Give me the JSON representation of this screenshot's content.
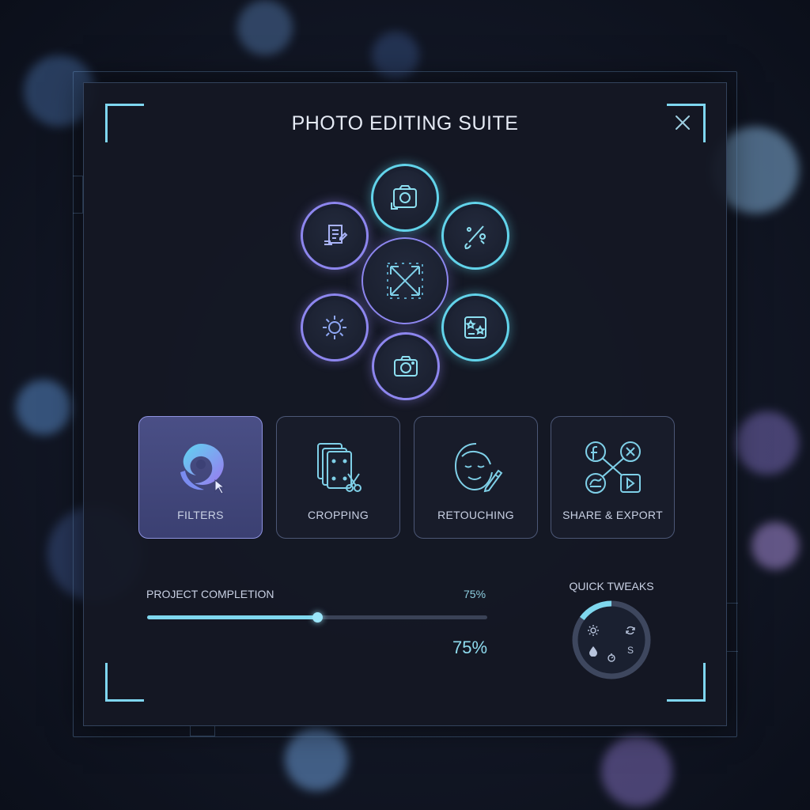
{
  "window": {
    "title": "PHOTO EDITING SUITE",
    "close_icon": "close-icon"
  },
  "tool_wheel": {
    "center_icon": "expand-arrows-icon",
    "tools": [
      {
        "icon": "camera-frame-icon",
        "color": "#62d3ea"
      },
      {
        "icon": "brush-icon",
        "color": "#62d3ea"
      },
      {
        "icon": "stickers-stars-icon",
        "color": "#62d3ea"
      },
      {
        "icon": "camera-icon",
        "color": "#8d86ee"
      },
      {
        "icon": "brightness-sun-icon",
        "color": "#8d86ee"
      },
      {
        "icon": "document-edit-icon",
        "color": "#8d86ee"
      }
    ]
  },
  "features": [
    {
      "label": "FILTERS",
      "icon": "filters-swirl-icon",
      "active": true
    },
    {
      "label": "CROPPING",
      "icon": "crop-scissors-icon",
      "active": false
    },
    {
      "label": "RETOUCHING",
      "icon": "face-retouch-icon",
      "active": false
    },
    {
      "label": "SHARE & EXPORT",
      "icon": "share-export-icon",
      "active": false
    }
  ],
  "progress": {
    "label": "PROJECT COMPLETION",
    "percent_text": "75%",
    "big_text": "75%",
    "value": 0.5
  },
  "quick_tweaks": {
    "title": "QUICK TWEAKS",
    "items": [
      {
        "icon": "brightness-icon",
        "text": ""
      },
      {
        "icon": "rotate-icon",
        "text": ""
      },
      {
        "icon": "droplet-icon",
        "text": ""
      },
      {
        "icon": "timer-icon",
        "text": ""
      },
      {
        "icon": "saturation-icon",
        "text": "S"
      }
    ],
    "arc_fraction": 0.15
  },
  "colors": {
    "accent_cyan": "#62d3ea",
    "accent_violet": "#8d86ee",
    "active_card": "#4a4f86"
  }
}
